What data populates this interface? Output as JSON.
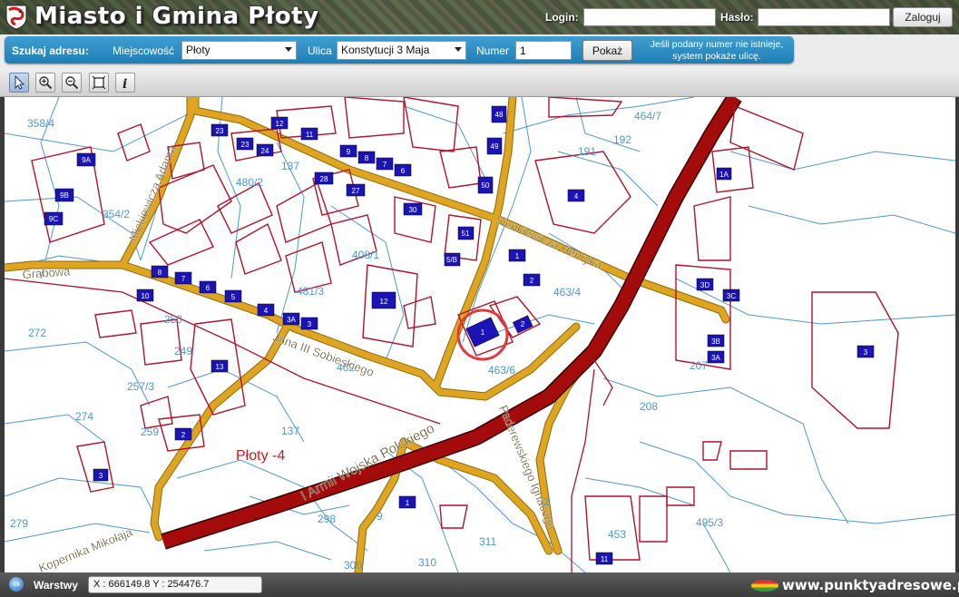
{
  "header": {
    "title": "Miasto i Gmina Płoty",
    "login_label": "Login:",
    "password_label": "Hasło:",
    "login_button": "Zaloguj",
    "login_value": "",
    "password_value": ""
  },
  "search": {
    "title": "Szukaj adresu:",
    "town_label": "Miejscowość",
    "town_value": "Płoty",
    "street_label": "Ulica",
    "street_value": "Konstytucji 3 Maja",
    "number_label": "Numer",
    "number_value": "1",
    "show_button": "Pokaż",
    "hint_line1": "Jeśli podany numer nie istnieje,",
    "hint_line2": "system pokaże ulicę."
  },
  "toolbar": {
    "tools": [
      "select-arrow-icon",
      "zoom-in-icon",
      "zoom-out-icon",
      "full-extent-icon",
      "info-icon"
    ]
  },
  "map": {
    "colors": {
      "parcel": "#4a98d8",
      "building": "#b3122a",
      "block": "#1a14b8",
      "road_fill": "#e0a520",
      "road_edge": "#8a6a10",
      "highway": "#a40b0b",
      "marker": "#e23a3a"
    },
    "district_label": "Płoty -4",
    "streets": {
      "grabowa": "Grabowa",
      "mickiewicza": "Mickiewicza Adama",
      "sobieskiego": "Jana III Sobieskiego",
      "sienkiewicza": "Sienkiewicza Henryka",
      "armii": "I Armii Wojska Polskiego",
      "paderewskiego": "Paderewskiego Ignacego",
      "kopernika": "Kopernika Mikołaja"
    },
    "parcels": {
      "p358_4": "358/4",
      "p354_2": "354/2",
      "p137a": "137",
      "p480_2": "480/2",
      "p408_1": "408/1",
      "p481_3": "481/3",
      "p462": "462",
      "p272": "272",
      "p250": "250",
      "p249": "249",
      "p257_3": "257/3",
      "p274": "274",
      "p259": "259",
      "p137b": "137",
      "p279": "279",
      "p298": "298",
      "p300": "300",
      "p310": "310",
      "p311": "311",
      "p464_7": "464/7",
      "p191": "191",
      "p192": "192",
      "p463_4": "463/4",
      "p463_6": "463/6",
      "p207": "207",
      "p208": "208",
      "p453": "453",
      "p495_3": "495/3",
      "p2": "2",
      "p9": "9"
    },
    "blocks": {
      "b12": "12",
      "b11": "11",
      "b9": "9",
      "b8": "8",
      "b7": "7",
      "b6": "6",
      "b23": "23",
      "b24": "24",
      "b9a": "9A",
      "b9b": "9B",
      "b9c": "9C",
      "b28": "28",
      "b27": "27",
      "b30": "30",
      "b51": "51",
      "b5b": "5/B",
      "b49": "49",
      "b50": "50",
      "b48": "48",
      "b8a": "8",
      "b7a": "7",
      "b6a": "6",
      "b5a": "5",
      "b4a": "4",
      "b3a": "3A",
      "b3b": "3",
      "b10": "10",
      "b13": "13",
      "b2a": "2",
      "b1": "1",
      "b2": "2",
      "b2b": "2",
      "b1b": "1",
      "b12b": "12",
      "b3d": "3D",
      "b3c": "3C",
      "b3bb": "3B",
      "b3aa": "3A",
      "b3": "3",
      "b1a": "1A",
      "b4": "4",
      "b1c": "1",
      "b11b": "11"
    }
  },
  "status": {
    "ok_label": "ok",
    "layers_label": "Warstwy",
    "coordinates": "X : 666149.8  Y : 254476.7",
    "brand": "www.punktyadresowe.pl"
  }
}
